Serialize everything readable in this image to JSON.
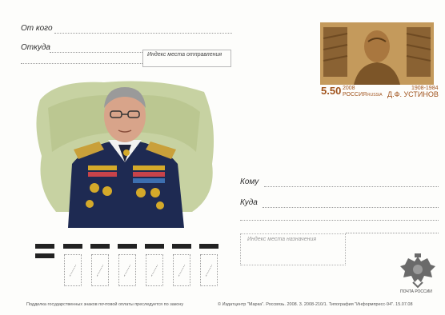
{
  "sender": {
    "from_label": "От кого",
    "where_from_label": "Откуда",
    "index_box_label": "Индекс места отправления"
  },
  "recipient": {
    "to_label": "Кому",
    "where_to_label": "Куда",
    "index_box_label": "Индекс места назначения"
  },
  "stamp": {
    "years": "2008",
    "life_years": "1908-1984",
    "value": "5.50",
    "country": "РОССИЯ",
    "country_latin": "RUSSIA",
    "name": "Д.Ф. УСТИНОВ"
  },
  "emblem": {
    "caption": "ПОЧТА РОССИИ"
  },
  "footer": {
    "left": "Подделка государственных знаков почтовой оплаты преследуется по закону",
    "right": "© Издатцентр \"Марка\". Россвязь. 2008. 3. 2008-210/1. Типография \"Информпресс-94\". 15.07.08"
  },
  "colors": {
    "stamp_bronze": "#b98a4a",
    "portrait_background": "#c7d2a2",
    "uniform": "#1e2a52"
  }
}
